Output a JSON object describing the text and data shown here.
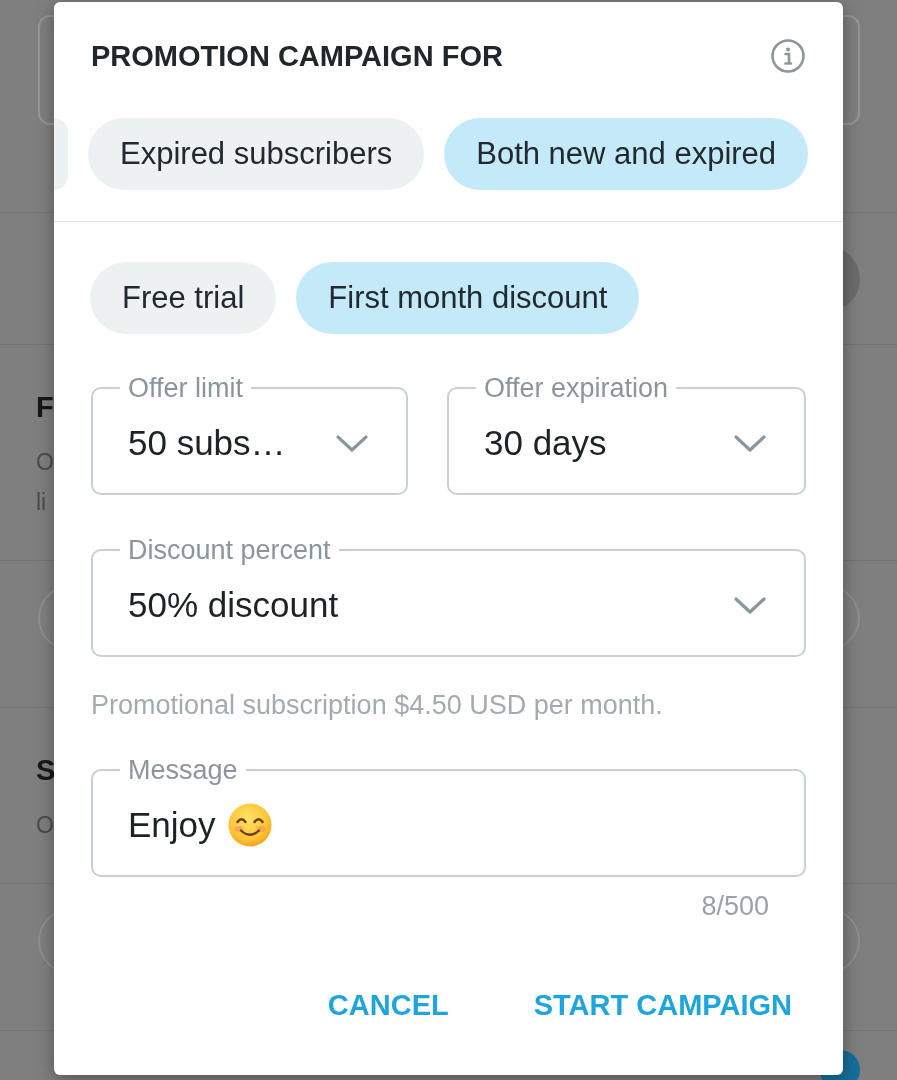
{
  "backdrop": {
    "sections": [
      {
        "kind": "outlined_box"
      },
      {
        "kind": "round_button"
      },
      {
        "kind": "text",
        "heading": "F",
        "lines": [
          "O",
          "li"
        ]
      },
      {
        "kind": "pill_field"
      },
      {
        "kind": "text",
        "heading": "S",
        "lines": [
          "O"
        ]
      },
      {
        "kind": "pill_field"
      },
      {
        "kind": "toggle"
      }
    ]
  },
  "dialog": {
    "title": "PROMOTION CAMPAIGN FOR",
    "audience_options": [
      {
        "label": "Expired subscribers",
        "selected": false
      },
      {
        "label": "Both new and expired",
        "selected": true
      }
    ],
    "offer_types": [
      {
        "label": "Free trial",
        "selected": false
      },
      {
        "label": "First month discount",
        "selected": true
      }
    ],
    "offer_limit": {
      "label": "Offer limit",
      "value": "50 subs…"
    },
    "offer_expiration": {
      "label": "Offer expiration",
      "value": "30 days"
    },
    "discount_percent": {
      "label": "Discount percent",
      "value": "50% discount"
    },
    "price_note": "Promotional subscription $4.50 USD per month.",
    "message": {
      "label": "Message",
      "value": "Enjoy",
      "counter": "8/500"
    },
    "buttons": [
      {
        "label": "CANCEL"
      },
      {
        "label": "START CAMPAIGN"
      }
    ]
  }
}
